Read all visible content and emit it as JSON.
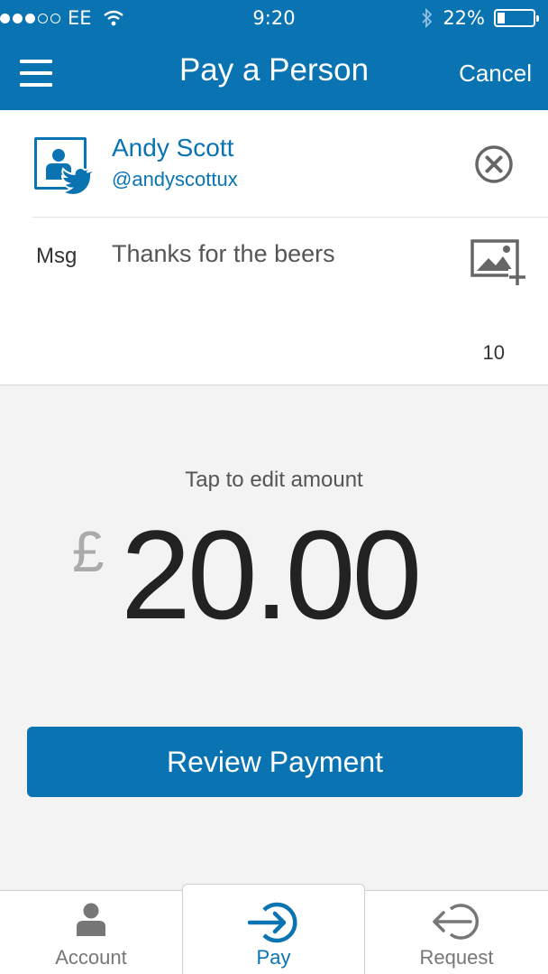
{
  "status_bar": {
    "carrier": "EE",
    "time": "9:20",
    "battery": "22%",
    "battery_level": 0.22,
    "signal_bars_filled": 3,
    "signal_bars_total": 5
  },
  "nav": {
    "title": "Pay a Person",
    "cancel_label": "Cancel",
    "menu_icon": "hamburger-icon"
  },
  "recipient": {
    "name": "Andy Scott",
    "handle": "@andyscottux",
    "avatar_icon": "contact-icon",
    "badge_icon": "twitter-icon",
    "clear_icon": "close-circle-icon"
  },
  "message": {
    "label": "Msg",
    "value": "Thanks for the beers",
    "add_image_icon": "add-image-icon",
    "char_counter": "10"
  },
  "amount": {
    "hint": "Tap to edit amount",
    "currency": "£",
    "value": "20.00"
  },
  "review_button": "Review Payment",
  "tabs": [
    {
      "label": "Account",
      "icon": "person-icon",
      "active": false
    },
    {
      "label": "Pay",
      "icon": "pay-arrow-icon",
      "active": true
    },
    {
      "label": "Request",
      "icon": "request-arrow-icon",
      "active": false
    }
  ],
  "colors": {
    "brand_blue": "#0a74b3",
    "background": "#f3f3f3"
  }
}
